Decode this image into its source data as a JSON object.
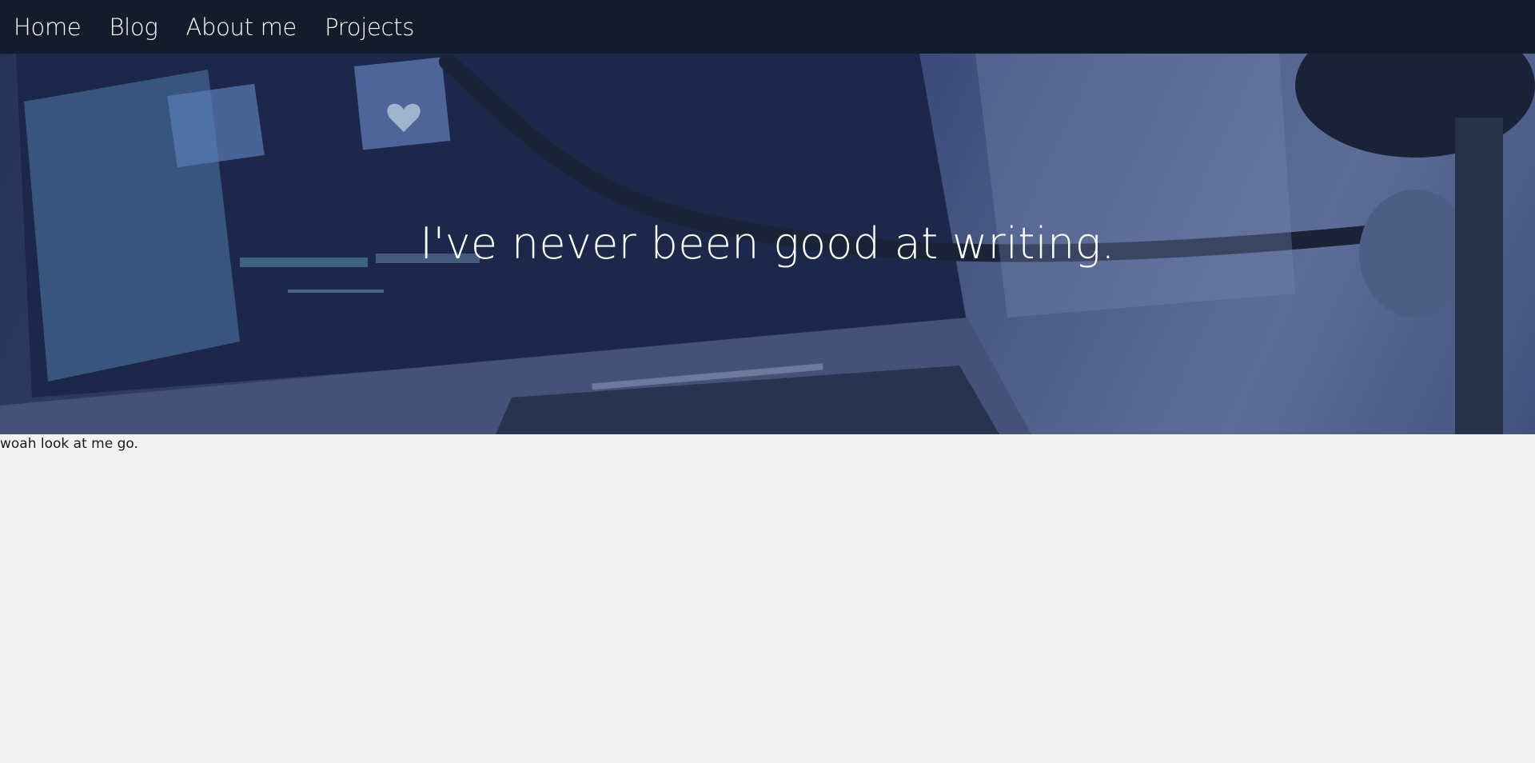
{
  "nav": {
    "items": [
      {
        "label": "Home"
      },
      {
        "label": "Blog"
      },
      {
        "label": "About me"
      },
      {
        "label": "Projects"
      }
    ]
  },
  "hero": {
    "title": "I've never been good at writing.",
    "image_alt": "Laptop with music app and desk lamp, blue tint"
  },
  "content": {
    "caption": "woah look at me go."
  },
  "colors": {
    "navbar": "#131c2b",
    "hero_tint": "#3c4c7e",
    "page_background": "#f2f2f2"
  }
}
